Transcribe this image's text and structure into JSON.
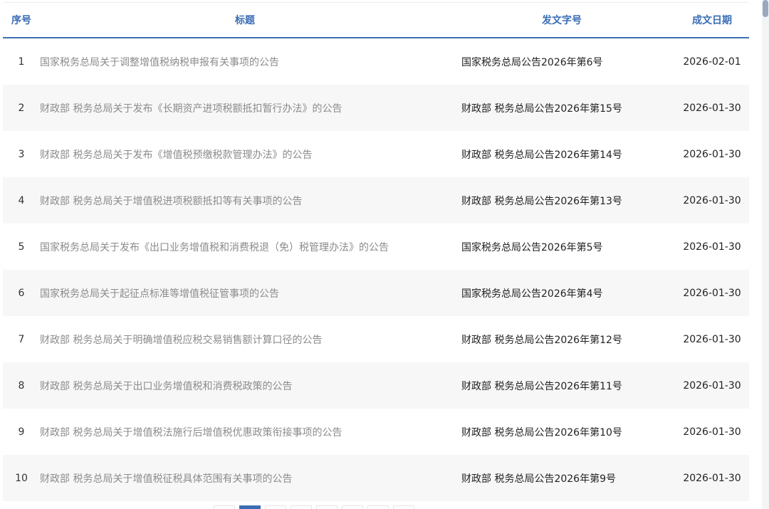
{
  "table": {
    "headers": {
      "index": "序号",
      "title": "标题",
      "doc_no": "发文字号",
      "date": "成文日期"
    },
    "rows": [
      {
        "index": "1",
        "title": "国家税务总局关于调整增值税纳税申报有关事项的公告",
        "doc_no": "国家税务总局公告2026年第6号",
        "date": "2026-02-01"
      },
      {
        "index": "2",
        "title": "财政部 税务总局关于发布《长期资产进项税额抵扣暂行办法》的公告",
        "doc_no": "财政部 税务总局公告2026年第15号",
        "date": "2026-01-30"
      },
      {
        "index": "3",
        "title": "财政部 税务总局关于发布《增值税预缴税款管理办法》的公告",
        "doc_no": "财政部 税务总局公告2026年第14号",
        "date": "2026-01-30"
      },
      {
        "index": "4",
        "title": "财政部 税务总局关于增值税进项税额抵扣等有关事项的公告",
        "doc_no": "财政部 税务总局公告2026年第13号",
        "date": "2026-01-30"
      },
      {
        "index": "5",
        "title": "国家税务总局关于发布《出口业务增值税和消费税退（免）税管理办法》的公告",
        "doc_no": "国家税务总局公告2026年第5号",
        "date": "2026-01-30"
      },
      {
        "index": "6",
        "title": "国家税务总局关于起征点标准等增值税征管事项的公告",
        "doc_no": "国家税务总局公告2026年第4号",
        "date": "2026-01-30"
      },
      {
        "index": "7",
        "title": "财政部 税务总局关于明确增值税应税交易销售额计算口径的公告",
        "doc_no": "财政部 税务总局公告2026年第12号",
        "date": "2026-01-30"
      },
      {
        "index": "8",
        "title": "财政部 税务总局关于出口业务增值税和消费税政策的公告",
        "doc_no": "财政部 税务总局公告2026年第11号",
        "date": "2026-01-30"
      },
      {
        "index": "9",
        "title": "财政部 税务总局关于增值税法施行后增值税优惠政策衔接事项的公告",
        "doc_no": "财政部 税务总局公告2026年第10号",
        "date": "2026-01-30"
      },
      {
        "index": "10",
        "title": "财政部 税务总局关于增值税征税具体范围有关事项的公告",
        "doc_no": "财政部 税务总局公告2026年第9号",
        "date": "2026-01-30"
      }
    ]
  },
  "colors": {
    "header_text": "#3a6db5",
    "header_rule": "#3d6fb6",
    "title_text": "#8b8b8b",
    "stripe": "#f7f7f7"
  }
}
